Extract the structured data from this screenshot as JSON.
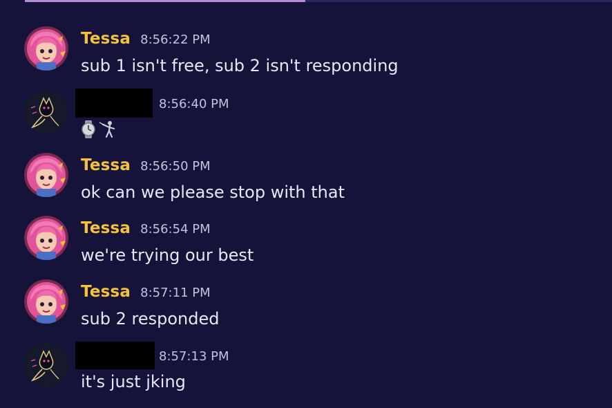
{
  "messages": [
    {
      "author": "Tessa",
      "time": "8:56:22 PM",
      "text": "sub 1 isn't free, sub 2 isn't responding"
    },
    {
      "author": "",
      "time": "8:56:40 PM",
      "text": "",
      "icons": [
        "watch-emoji",
        "person-fencing-emoji"
      ]
    },
    {
      "author": "Tessa",
      "time": "8:56:50 PM",
      "text": "ok can we please stop with that"
    },
    {
      "author": "Tessa",
      "time": "8:56:54 PM",
      "text": "we're trying our best"
    },
    {
      "author": "Tessa",
      "time": "8:57:11 PM",
      "text": "sub 2 responded"
    },
    {
      "author": "",
      "time": "8:57:13 PM",
      "text": "it's just jking"
    }
  ],
  "colors": {
    "background": "#16133b",
    "author_name": "#f4c33b",
    "timestamp": "#c5c2dc",
    "message_text": "#e9e7f5",
    "redaction": "#000000"
  }
}
